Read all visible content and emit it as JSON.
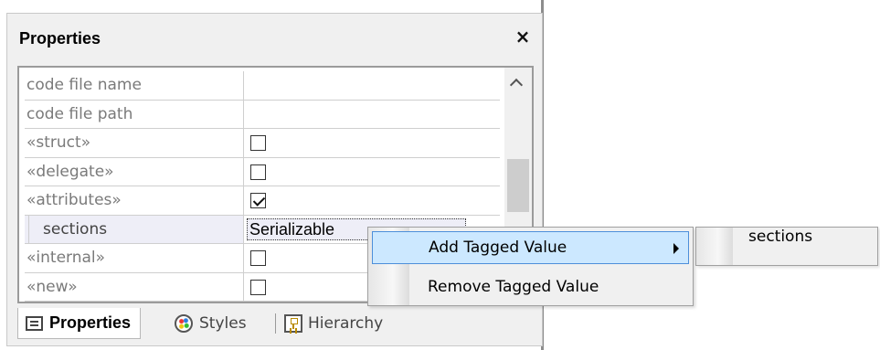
{
  "panel": {
    "title": "Properties",
    "close_glyph": "×"
  },
  "properties": [
    {
      "name": "code file name",
      "type": "text",
      "value": ""
    },
    {
      "name": "code file path",
      "type": "text",
      "value": ""
    },
    {
      "name": "«struct»",
      "type": "checkbox",
      "checked": false
    },
    {
      "name": "«delegate»",
      "type": "checkbox",
      "checked": false
    },
    {
      "name": "«attributes»",
      "type": "checkbox",
      "checked": true
    },
    {
      "name": "sections",
      "type": "tagged",
      "value": "Serializable"
    },
    {
      "name": "«internal»",
      "type": "checkbox",
      "checked": false
    },
    {
      "name": "«new»",
      "type": "checkbox",
      "checked": false
    }
  ],
  "tabs": [
    {
      "label": "Properties",
      "icon": "properties-list-icon",
      "active": true
    },
    {
      "label": "Styles",
      "icon": "palette-icon",
      "active": false
    },
    {
      "label": "Hierarchy",
      "icon": "hierarchy-icon",
      "active": false
    }
  ],
  "context_menu": {
    "items": [
      {
        "label": "Add Tagged Value",
        "has_submenu": true,
        "highlighted": true
      },
      {
        "label": "Remove Tagged Value",
        "has_submenu": false,
        "highlighted": false
      }
    ]
  },
  "submenu": {
    "items": [
      {
        "label": "sections"
      }
    ]
  },
  "colors": {
    "menu_highlight": "#cce8ff",
    "menu_highlight_border": "#4d8fda",
    "tagged_row_bg": "#eeeef7"
  }
}
